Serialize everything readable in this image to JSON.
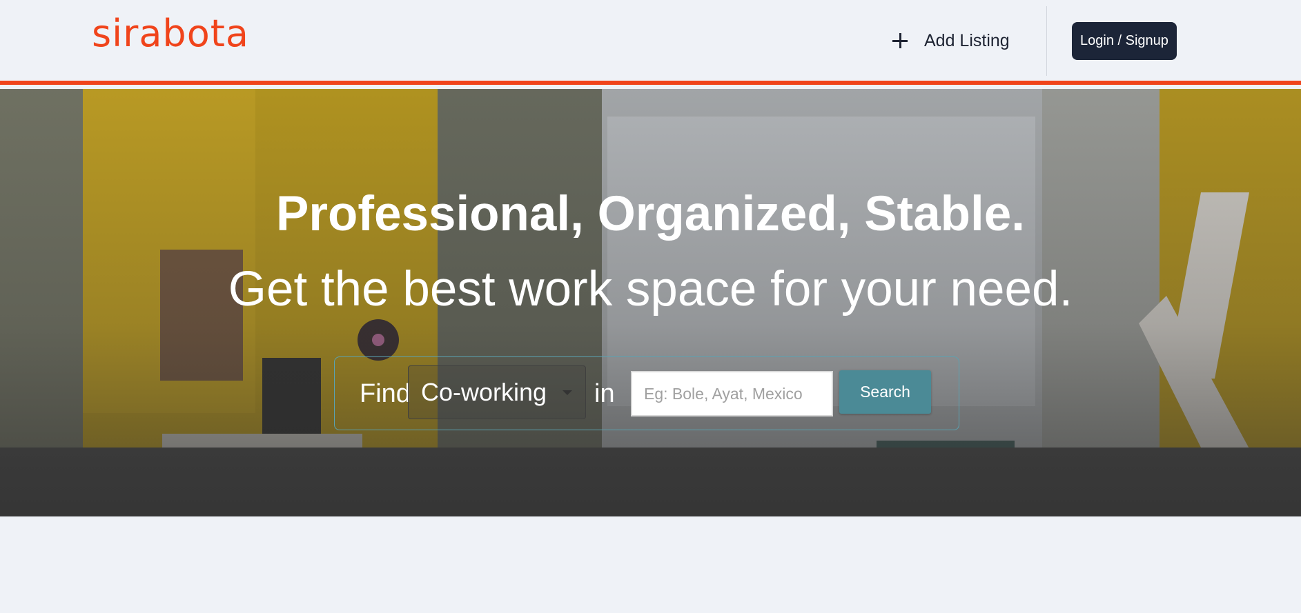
{
  "brand": {
    "logo_text": "sirabota",
    "accent_color": "#f0441b"
  },
  "header": {
    "add_listing_label": "Add Listing",
    "login_label": "Login / Signup",
    "plus_icon": "plus-icon"
  },
  "hero": {
    "headline": "Professional, Organized, Stable.",
    "subheadline": "Get the best work space for your need."
  },
  "search": {
    "find_label": "Find",
    "category_selected": "Co-working",
    "in_label": "in",
    "location_placeholder": "Eg: Bole, Ayat, Mexico",
    "search_button_label": "Search",
    "button_color": "#4b8a96"
  }
}
